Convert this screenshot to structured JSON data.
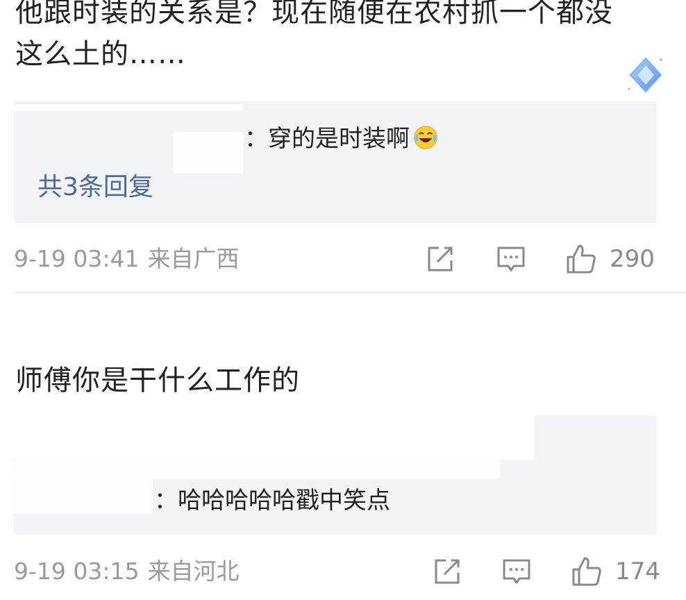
{
  "comments": [
    {
      "text": "他跟时装的关系是？现在随便在农村抓一个都没这么土的……",
      "reply": {
        "text": "：穿的是时装啊",
        "emoji": "laughing-crying-emoji",
        "count_label": "共3条回复"
      },
      "time": "9-19 03:41",
      "location": "来自广西",
      "likes": "290"
    },
    {
      "text": "师傅你是干什么工作的",
      "reply": {
        "text": "：哈哈哈哈哈戳中笑点"
      },
      "time": "9-19 03:15",
      "location": "来自河北",
      "likes": "174"
    }
  ],
  "icons": {
    "share": "share-icon",
    "comment": "comment-icon",
    "like": "like-icon",
    "badge": "diamond-badge-icon"
  },
  "colors": {
    "link": "#4d6a9a",
    "meta": "#9a9a9a",
    "reply_bg": "#f3f4f7"
  }
}
